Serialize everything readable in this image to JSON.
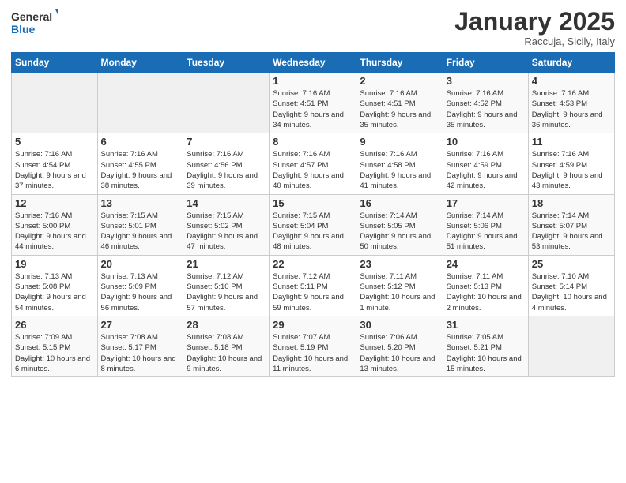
{
  "logo": {
    "general": "General",
    "blue": "Blue"
  },
  "header": {
    "month": "January 2025",
    "location": "Raccuja, Sicily, Italy"
  },
  "weekdays": [
    "Sunday",
    "Monday",
    "Tuesday",
    "Wednesday",
    "Thursday",
    "Friday",
    "Saturday"
  ],
  "weeks": [
    [
      {
        "day": "",
        "info": ""
      },
      {
        "day": "",
        "info": ""
      },
      {
        "day": "",
        "info": ""
      },
      {
        "day": "1",
        "info": "Sunrise: 7:16 AM\nSunset: 4:51 PM\nDaylight: 9 hours\nand 34 minutes."
      },
      {
        "day": "2",
        "info": "Sunrise: 7:16 AM\nSunset: 4:51 PM\nDaylight: 9 hours\nand 35 minutes."
      },
      {
        "day": "3",
        "info": "Sunrise: 7:16 AM\nSunset: 4:52 PM\nDaylight: 9 hours\nand 35 minutes."
      },
      {
        "day": "4",
        "info": "Sunrise: 7:16 AM\nSunset: 4:53 PM\nDaylight: 9 hours\nand 36 minutes."
      }
    ],
    [
      {
        "day": "5",
        "info": "Sunrise: 7:16 AM\nSunset: 4:54 PM\nDaylight: 9 hours\nand 37 minutes."
      },
      {
        "day": "6",
        "info": "Sunrise: 7:16 AM\nSunset: 4:55 PM\nDaylight: 9 hours\nand 38 minutes."
      },
      {
        "day": "7",
        "info": "Sunrise: 7:16 AM\nSunset: 4:56 PM\nDaylight: 9 hours\nand 39 minutes."
      },
      {
        "day": "8",
        "info": "Sunrise: 7:16 AM\nSunset: 4:57 PM\nDaylight: 9 hours\nand 40 minutes."
      },
      {
        "day": "9",
        "info": "Sunrise: 7:16 AM\nSunset: 4:58 PM\nDaylight: 9 hours\nand 41 minutes."
      },
      {
        "day": "10",
        "info": "Sunrise: 7:16 AM\nSunset: 4:59 PM\nDaylight: 9 hours\nand 42 minutes."
      },
      {
        "day": "11",
        "info": "Sunrise: 7:16 AM\nSunset: 4:59 PM\nDaylight: 9 hours\nand 43 minutes."
      }
    ],
    [
      {
        "day": "12",
        "info": "Sunrise: 7:16 AM\nSunset: 5:00 PM\nDaylight: 9 hours\nand 44 minutes."
      },
      {
        "day": "13",
        "info": "Sunrise: 7:15 AM\nSunset: 5:01 PM\nDaylight: 9 hours\nand 46 minutes."
      },
      {
        "day": "14",
        "info": "Sunrise: 7:15 AM\nSunset: 5:02 PM\nDaylight: 9 hours\nand 47 minutes."
      },
      {
        "day": "15",
        "info": "Sunrise: 7:15 AM\nSunset: 5:04 PM\nDaylight: 9 hours\nand 48 minutes."
      },
      {
        "day": "16",
        "info": "Sunrise: 7:14 AM\nSunset: 5:05 PM\nDaylight: 9 hours\nand 50 minutes."
      },
      {
        "day": "17",
        "info": "Sunrise: 7:14 AM\nSunset: 5:06 PM\nDaylight: 9 hours\nand 51 minutes."
      },
      {
        "day": "18",
        "info": "Sunrise: 7:14 AM\nSunset: 5:07 PM\nDaylight: 9 hours\nand 53 minutes."
      }
    ],
    [
      {
        "day": "19",
        "info": "Sunrise: 7:13 AM\nSunset: 5:08 PM\nDaylight: 9 hours\nand 54 minutes."
      },
      {
        "day": "20",
        "info": "Sunrise: 7:13 AM\nSunset: 5:09 PM\nDaylight: 9 hours\nand 56 minutes."
      },
      {
        "day": "21",
        "info": "Sunrise: 7:12 AM\nSunset: 5:10 PM\nDaylight: 9 hours\nand 57 minutes."
      },
      {
        "day": "22",
        "info": "Sunrise: 7:12 AM\nSunset: 5:11 PM\nDaylight: 9 hours\nand 59 minutes."
      },
      {
        "day": "23",
        "info": "Sunrise: 7:11 AM\nSunset: 5:12 PM\nDaylight: 10 hours\nand 1 minute."
      },
      {
        "day": "24",
        "info": "Sunrise: 7:11 AM\nSunset: 5:13 PM\nDaylight: 10 hours\nand 2 minutes."
      },
      {
        "day": "25",
        "info": "Sunrise: 7:10 AM\nSunset: 5:14 PM\nDaylight: 10 hours\nand 4 minutes."
      }
    ],
    [
      {
        "day": "26",
        "info": "Sunrise: 7:09 AM\nSunset: 5:15 PM\nDaylight: 10 hours\nand 6 minutes."
      },
      {
        "day": "27",
        "info": "Sunrise: 7:08 AM\nSunset: 5:17 PM\nDaylight: 10 hours\nand 8 minutes."
      },
      {
        "day": "28",
        "info": "Sunrise: 7:08 AM\nSunset: 5:18 PM\nDaylight: 10 hours\nand 9 minutes."
      },
      {
        "day": "29",
        "info": "Sunrise: 7:07 AM\nSunset: 5:19 PM\nDaylight: 10 hours\nand 11 minutes."
      },
      {
        "day": "30",
        "info": "Sunrise: 7:06 AM\nSunset: 5:20 PM\nDaylight: 10 hours\nand 13 minutes."
      },
      {
        "day": "31",
        "info": "Sunrise: 7:05 AM\nSunset: 5:21 PM\nDaylight: 10 hours\nand 15 minutes."
      },
      {
        "day": "",
        "info": ""
      }
    ]
  ]
}
